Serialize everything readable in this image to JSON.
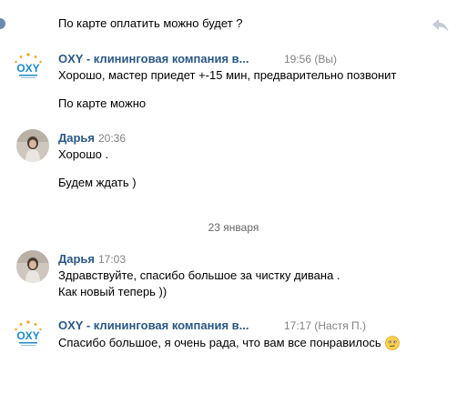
{
  "top": {
    "text": "По карте оплатить можно будет ?",
    "reply_icon": "reply-arrow-icon",
    "check_icon": "checkmark-icon"
  },
  "messages": [
    {
      "author": "OXY - клининговая компания в...",
      "time": "19:56 (Вы)",
      "avatar": "oxy-logo",
      "lines": [
        "Хорошо, мастер приедет +-15 мин, предварительно позвонит",
        "По карте можно"
      ]
    },
    {
      "author": "Дарья",
      "time": "20:36",
      "avatar": "user-photo",
      "lines": [
        "Хорошо .",
        "Будем ждать )"
      ]
    },
    {
      "author": "Дарья",
      "time": "17:03",
      "avatar": "user-photo",
      "lines": [
        "Здравствуйте, спасибо большое за чистку дивана .",
        "Как новый теперь ))"
      ]
    },
    {
      "author": "OXY - клининговая компания в...",
      "time": "17:17 (Настя П.)",
      "avatar": "oxy-logo",
      "lines": [
        "Спасибо большое, я очень рада, что вам все понравилось"
      ],
      "emoji": "confused-face-emoji"
    }
  ],
  "date_separator": "23 января",
  "logo_text": "OXY",
  "colors": {
    "author": "#2a5885",
    "time": "#828282",
    "text": "#000000",
    "logo_blue": "#1e88c8",
    "logo_orange": "#f3a21e"
  }
}
